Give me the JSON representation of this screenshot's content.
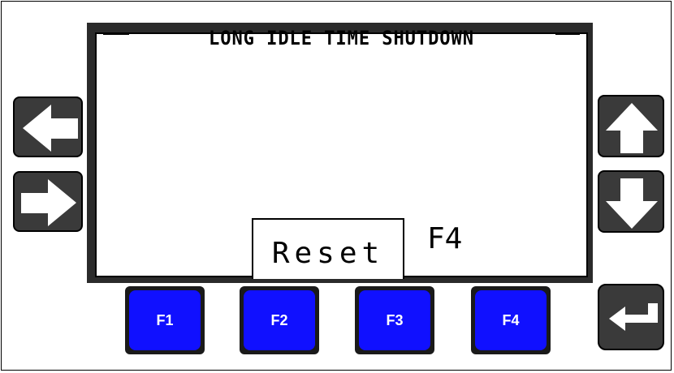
{
  "screen": {
    "title": "LONG IDLE TIME SHUTDOWN",
    "reset_label": "Reset",
    "softkey_hint": "F4"
  },
  "navigation": {
    "left_icon": "arrow-left-icon",
    "right_icon": "arrow-right-icon",
    "up_icon": "arrow-up-icon",
    "down_icon": "arrow-down-icon",
    "enter_icon": "enter-icon"
  },
  "function_keys": [
    {
      "label": "F1"
    },
    {
      "label": "F2"
    },
    {
      "label": "F3"
    },
    {
      "label": "F4"
    }
  ],
  "colors": {
    "function_key": "#1010ff",
    "nav_key": "#3a3a3a",
    "screen_bezel": "#2b2b2b"
  }
}
